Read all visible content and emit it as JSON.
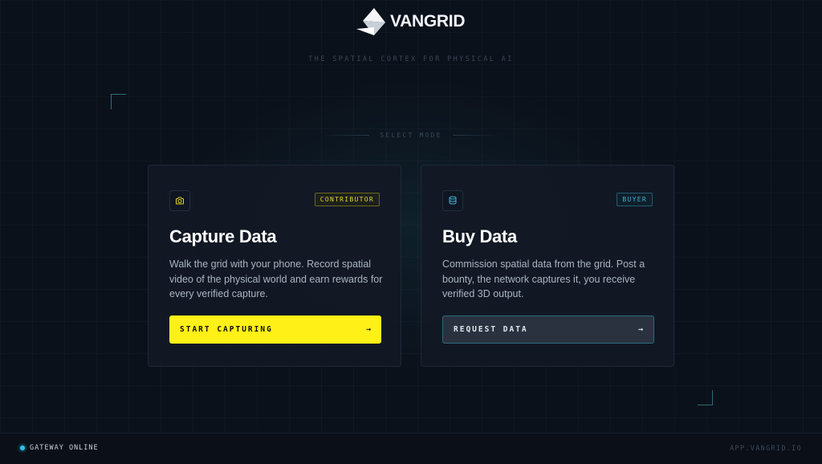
{
  "brand": {
    "name": "VANGRID",
    "tagline": "THE SPATIAL CORTEX FOR PHYSICAL AI",
    "logo_icon": "paper-plane-wedge-icon"
  },
  "mode_select": {
    "label": "SELECT MODE"
  },
  "cards": [
    {
      "icon": "camera-icon",
      "badge": "CONTRIBUTOR",
      "title": "Capture Data",
      "description": "Walk the grid with your phone. Record spatial video of the physical world and earn rewards for every verified capture.",
      "cta_label": "START CAPTURING",
      "cta_arrow": "→",
      "accent_color": "#fff017"
    },
    {
      "icon": "database-icon",
      "badge": "BUYER",
      "title": "Buy Data",
      "description": "Commission spatial data from the grid. Post a bounty, the network captures it, you receive verified 3D output.",
      "cta_label": "REQUEST DATA",
      "cta_arrow": "→",
      "accent_color": "#3fb3d6"
    }
  ],
  "footer": {
    "status_text": "GATEWAY ONLINE",
    "status_color": "#2bc3e6",
    "app_url": "APP.VANGRID.IO"
  }
}
